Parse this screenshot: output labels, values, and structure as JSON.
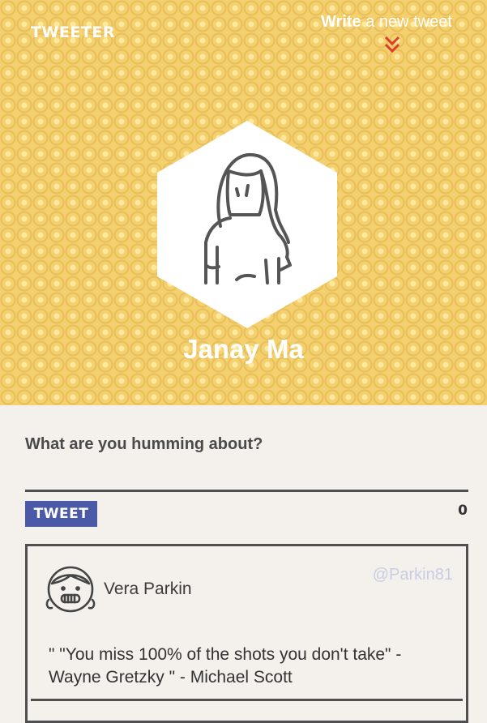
{
  "header": {
    "brand": "TWEETER",
    "write_bold": "Write",
    "write_rest": " a new tweet",
    "chevron_icon": "double-chevron-down-icon",
    "chevron_color": "#d9402b",
    "background_color": "#f5d06f"
  },
  "profile": {
    "name": "Janay Ma",
    "avatar_icon": "woman-portrait-icon"
  },
  "compose": {
    "prompt": "What are you humming about?",
    "value": "",
    "placeholder": "",
    "tweet_button": "TWEET",
    "char_count": "0",
    "button_color": "#4a5aa6"
  },
  "feed": [
    {
      "name": "Vera Parkin",
      "handle": "@Parkin81",
      "avatar_icon": "smiling-girl-icon",
      "text": "\" \"You miss 100% of the shots you don't take\" - Wayne Gretzky \" - Michael Scott"
    }
  ]
}
